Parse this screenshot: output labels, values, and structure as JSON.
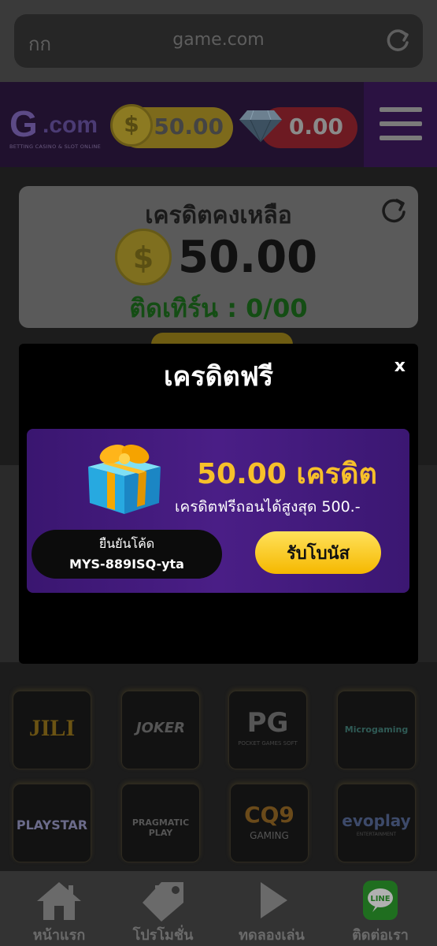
{
  "browser": {
    "text_size_label": "กก",
    "url": "game.com",
    "reload_icon": "reload-icon"
  },
  "header": {
    "logo_main": "G",
    "logo_suffix": ".com",
    "logo_tagline": "BETTING CASINO & SLOT ONLINE",
    "coin_balance": "50.00",
    "coin_symbol": "$",
    "gem_balance": "0.00",
    "menu_icon": "hamburger-menu-icon"
  },
  "credit_card": {
    "title": "เครดิตคงเหลือ",
    "coin_symbol": "$",
    "amount": "50.00",
    "turnover": "ติดเทิร์น : 0/00"
  },
  "modal": {
    "title": "เครดิตฟรี",
    "close_label": "x",
    "bonus_amount": "50.00 เครดิต",
    "bonus_desc": "เครดิตฟรีถอนได้สูงสุด  500.-",
    "code_label": "ยืนยันโค้ด",
    "code_value": "MYS-889ISQ-yta",
    "claim_label": "รับโบนัส"
  },
  "games": [
    {
      "name": "JILI"
    },
    {
      "name": "JOKER"
    },
    {
      "name": "PG",
      "sub": "POCKET GAMES SOFT"
    },
    {
      "name": "Microgaming"
    },
    {
      "name": "PLAYSTAR"
    },
    {
      "name": "PRAGMATIC PLAY"
    },
    {
      "name": "CQ9",
      "sub": "GAMING"
    },
    {
      "name": "evoplay",
      "sub": "ENTERTAINMENT"
    }
  ],
  "bottom_nav": [
    {
      "label": "หน้าแรก",
      "icon": "home-icon"
    },
    {
      "label": "โปรโมชั่น",
      "icon": "tag-icon"
    },
    {
      "label": "ทดลองเล่น",
      "icon": "play-icon"
    },
    {
      "label": "ติดต่อเรา",
      "icon": "line-icon",
      "icon_text": "LINE"
    }
  ],
  "colors": {
    "accent_yellow": "#f5b800",
    "bonus_purple": "#4a1e86",
    "line_green": "#1f6e1f"
  }
}
